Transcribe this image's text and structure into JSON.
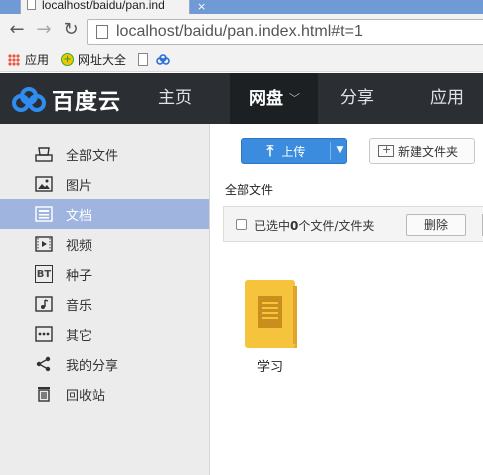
{
  "browser": {
    "tab_title": "localhost/baidu/pan.ind",
    "tab_close": "×",
    "url": "localhost/baidu/pan.index.html#t=1",
    "bookmarks": [
      {
        "label": "应用",
        "icon": "apps-grid-icon"
      },
      {
        "label": "网址大全",
        "icon": "hao123-icon"
      }
    ]
  },
  "app": {
    "logo_text": "百度云",
    "nav": [
      {
        "label": "主页"
      },
      {
        "label": "网盘",
        "active": true
      },
      {
        "label": "分享"
      },
      {
        "label": "应用"
      }
    ]
  },
  "sidebar": {
    "items": [
      {
        "label": "全部文件",
        "icon": "all-files-icon"
      },
      {
        "label": "图片",
        "icon": "picture-icon"
      },
      {
        "label": "文档",
        "icon": "document-icon",
        "active": true
      },
      {
        "label": "视频",
        "icon": "video-icon"
      },
      {
        "label": "种子",
        "icon": "torrent-icon",
        "icon_text": "BT"
      },
      {
        "label": "音乐",
        "icon": "music-icon"
      },
      {
        "label": "其它",
        "icon": "other-icon"
      },
      {
        "label": "我的分享",
        "icon": "share-icon"
      },
      {
        "label": "回收站",
        "icon": "recycle-bin-icon"
      }
    ]
  },
  "main": {
    "upload_label": "上传",
    "new_folder_label": "新建文件夹",
    "breadcrumb": "全部文件",
    "selection": {
      "prefix": "已选中",
      "count": "0",
      "suffix": "个文件/文件夹"
    },
    "delete_label": "删除",
    "files": [
      {
        "name": "学习",
        "type": "folder"
      }
    ]
  },
  "colors": {
    "header_bg": "#2b2f33",
    "sidebar_active": "#9fb5e0",
    "upload_blue": "#3b8cdf",
    "folder_yellow": "#f6c33d"
  }
}
